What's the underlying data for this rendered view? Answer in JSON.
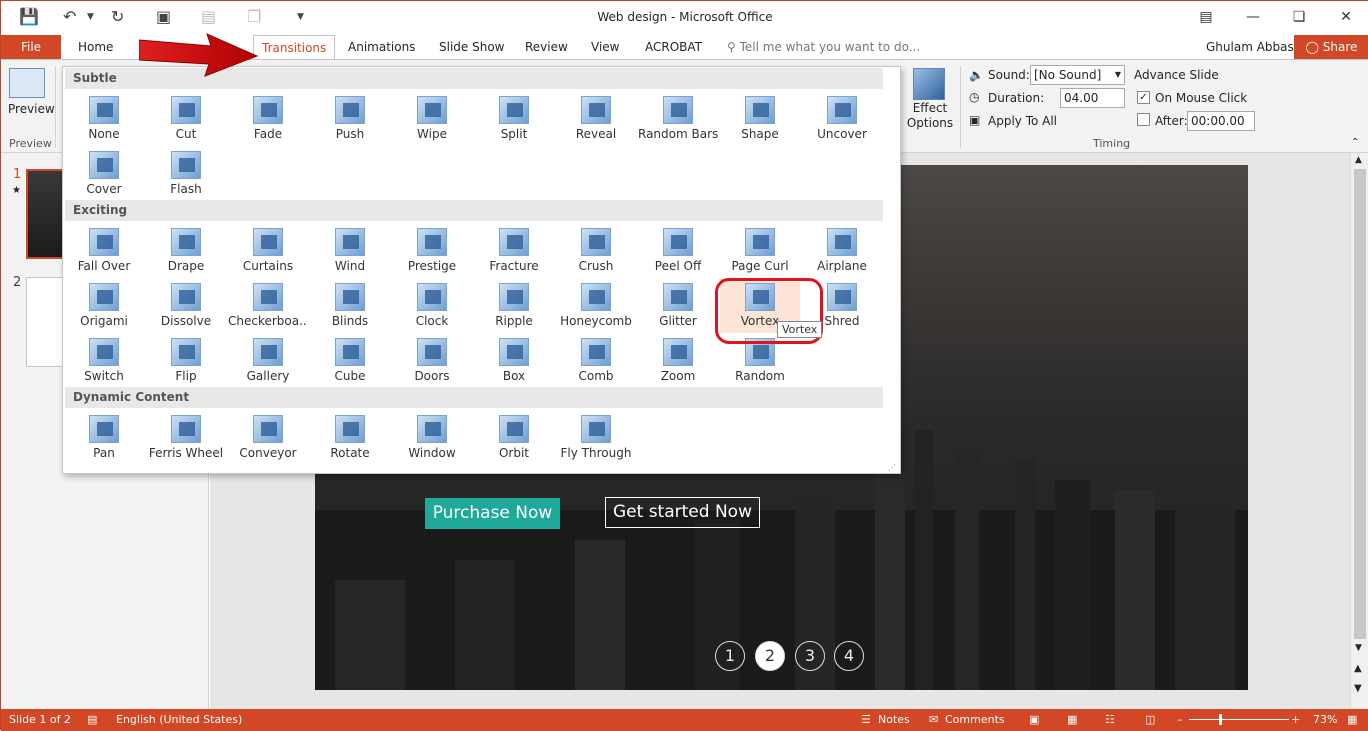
{
  "window": {
    "title": "Web design - Microsoft Office"
  },
  "tabs": [
    "File",
    "Home",
    "Transitions",
    "Animations",
    "Slide Show",
    "Review",
    "View",
    "ACROBAT"
  ],
  "tellme": "Tell me what you want to do...",
  "user": "Ghulam Abbas",
  "share": "Share",
  "ribbon": {
    "preview_label": "Preview",
    "preview_group": "Preview",
    "effect_options": "Effect Options",
    "sound_label": "Sound:",
    "sound_value": "[No Sound]",
    "duration_label": "Duration:",
    "duration_value": "04.00",
    "apply_all": "Apply To All",
    "advance_title": "Advance Slide",
    "on_mouse_click": "On Mouse Click",
    "after_label": "After:",
    "after_value": "00:00.00",
    "timing_group": "Timing"
  },
  "gallery": {
    "sections": [
      "Subtle",
      "Exciting",
      "Dynamic Content"
    ],
    "subtle": [
      "None",
      "Cut",
      "Fade",
      "Push",
      "Wipe",
      "Split",
      "Reveal",
      "Random Bars",
      "Shape",
      "Uncover",
      "Cover",
      "Flash"
    ],
    "exciting": [
      "Fall Over",
      "Drape",
      "Curtains",
      "Wind",
      "Prestige",
      "Fracture",
      "Crush",
      "Peel Off",
      "Page Curl",
      "Airplane",
      "Origami",
      "Dissolve",
      "Checkerboa...",
      "Blinds",
      "Clock",
      "Ripple",
      "Honeycomb",
      "Glitter",
      "Vortex",
      "Shred",
      "Switch",
      "Flip",
      "Gallery",
      "Cube",
      "Doors",
      "Box",
      "Comb",
      "Zoom",
      "Random"
    ],
    "dynamic": [
      "Pan",
      "Ferris Wheel",
      "Conveyor",
      "Rotate",
      "Window",
      "Orbit",
      "Fly Through"
    ],
    "tooltip": "Vortex"
  },
  "thumbnails": [
    "1",
    "2"
  ],
  "slide": {
    "purchase": "Purchase Now",
    "started": "Get started Now",
    "dots": [
      "1",
      "2",
      "3",
      "4"
    ]
  },
  "status": {
    "slide": "Slide 1 of 2",
    "language": "English (United States)",
    "notes": "Notes",
    "comments": "Comments",
    "zoom": "73%"
  }
}
